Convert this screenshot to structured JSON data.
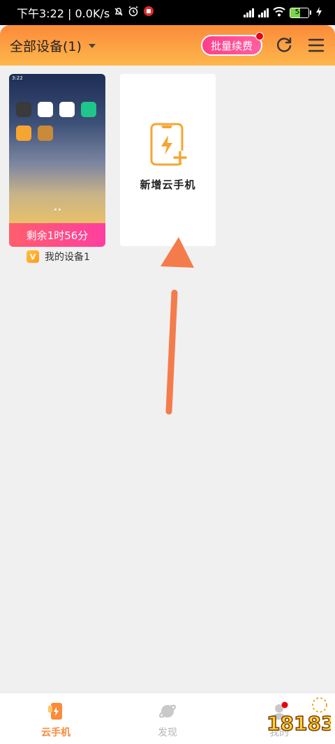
{
  "status_bar": {
    "time_network": "下午3:22 | 0.0K/s",
    "battery": "54"
  },
  "header": {
    "title": "全部设备(1)",
    "renew_button": "批量续费"
  },
  "devices": [
    {
      "name": "我的设备1",
      "remaining": "剩余1时56分",
      "vip_badge": "V",
      "screen_time": "3:22"
    }
  ],
  "add_card": {
    "label": "新增云手机"
  },
  "bottom_nav": {
    "items": [
      {
        "label": "云手机",
        "icon": "cloud-phone-icon",
        "active": true
      },
      {
        "label": "发现",
        "icon": "planet-icon",
        "active": false
      },
      {
        "label": "我的",
        "icon": "profile-icon",
        "active": false
      }
    ]
  },
  "watermark": {
    "text": "18183"
  },
  "colors": {
    "accent": "#fb8a3a",
    "pink": "#ff3ea1",
    "background": "#f0f0f0"
  }
}
